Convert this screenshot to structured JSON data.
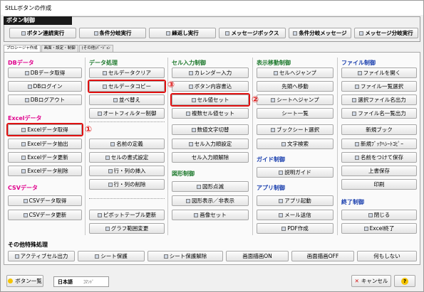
{
  "window": {
    "title": "StLLボタンの作成"
  },
  "section": {
    "title": "ボタン制御"
  },
  "top_buttons": [
    "ボタン連続実行",
    "条件分岐実行",
    "繰返し実行",
    "メッセージボックス",
    "条件分岐メッセージ",
    "メッセージ分岐実行"
  ],
  "tabs": [
    "プロシージャ作成",
    "画面・設定・制御",
    "(その他)ﾊﾞｰｼﾞｮﾝ"
  ],
  "columns": {
    "db": {
      "title": "DBデータ",
      "items": [
        "DBデータ取得",
        "DBログイン",
        "DBログアウト"
      ]
    },
    "excel": {
      "title": "Excelデータ",
      "items": [
        "Excelデータ取得",
        "Excelデータ抽出",
        "Excelデータ更新",
        "Excelデータ削除"
      ]
    },
    "csv": {
      "title": "CSVデータ",
      "items": [
        "CSVデータ取得",
        "CSVデータ更新"
      ]
    },
    "data": {
      "title": "データ処理",
      "items": [
        "セルデータクリア",
        "セルデータコピー",
        "並べ替え",
        "オートフィルター制御",
        "名前の定義",
        "セルの書式設定",
        "行・列の挿入",
        "行・列の削除",
        "ピボットテーブル更新",
        "グラフ範囲変更"
      ]
    },
    "cellinput": {
      "title": "セル入力制御",
      "items": [
        "カレンダー入力",
        "ボタン内容書込",
        "セル値セット",
        "複数セル値セット",
        "数値文字切替",
        "セル入力順設定",
        "セル入力順解除"
      ]
    },
    "shape": {
      "title": "図形制御",
      "items": [
        "図形点滅",
        "図形表示／非表示",
        "画像セット"
      ]
    },
    "move": {
      "title": "表示移動制御",
      "items": [
        "セルへジャンプ",
        "先頭へ移動",
        "シートへジャンプ",
        "シート一覧",
        "ブックシート選択",
        "文字検索"
      ]
    },
    "guide": {
      "title": "ガイド制御",
      "items": [
        "説明ガイド"
      ]
    },
    "app": {
      "title": "アプリ制御",
      "items": [
        "アプリ起動",
        "メール送信",
        "PDF作成"
      ]
    },
    "file": {
      "title": "ファイル制御",
      "items": [
        "ファイルを開く",
        "ファイル一覧選択",
        "選択ファイル名出力",
        "ファイル名一覧出力",
        "新規ブック",
        "新規ﾌﾞｯｸﾍｼｰﾄｺﾋﾟｰ",
        "名前をつけて保存",
        "上書保存",
        "印刷"
      ]
    },
    "end": {
      "title": "終了制御",
      "items": [
        "閉じる",
        "Excel終了"
      ]
    }
  },
  "other": {
    "title": "その他特殊処理",
    "items": [
      "アクティブセル出力",
      "シート保護",
      "シート保護解除",
      "画面描画ON",
      "画面描画OFF",
      "何もしない"
    ]
  },
  "annotations": [
    "①",
    "②",
    "③"
  ],
  "footer": {
    "list": "ボタン一覧",
    "lang_jp": "日本語",
    "lang_cmd": "ｺﾏﾝﾄﾞ",
    "cancel": "キャンセル",
    "help": "?"
  }
}
